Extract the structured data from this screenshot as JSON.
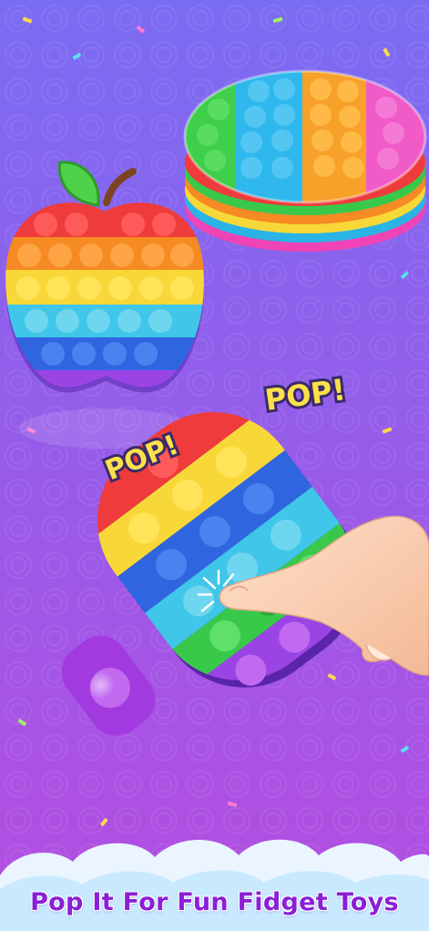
{
  "caption": "Pop It For Fun Fidget Toys",
  "sound_effects": [
    "POP!",
    "POP!"
  ],
  "colors": {
    "bg_top": "#7a6cf2",
    "bg_bottom": "#b44de0",
    "caption": "#8a1fd6",
    "pop_text": "#fbe04a",
    "rainbow": [
      "#ef3b3b",
      "#f68a23",
      "#f8d838",
      "#38c94b",
      "#3fc6e8",
      "#2f66e0",
      "#9b44e6",
      "#ec4fc6"
    ]
  },
  "icons": [
    "apple-popit-toy",
    "round-cake-popit-toy",
    "popsicle-popit-toy",
    "finger-pointer"
  ]
}
